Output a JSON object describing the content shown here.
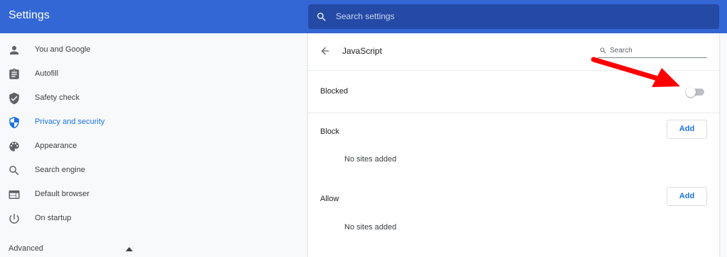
{
  "header": {
    "app_title": "Settings",
    "search_placeholder": "Search settings"
  },
  "sidebar": {
    "items": [
      {
        "label": "You and Google",
        "icon": "person-icon",
        "active": false
      },
      {
        "label": "Autofill",
        "icon": "clipboard-icon",
        "active": false
      },
      {
        "label": "Safety check",
        "icon": "shield-check-icon",
        "active": false
      },
      {
        "label": "Privacy and security",
        "icon": "shield-icon",
        "active": true
      },
      {
        "label": "Appearance",
        "icon": "palette-icon",
        "active": false
      },
      {
        "label": "Search engine",
        "icon": "search-icon",
        "active": false
      },
      {
        "label": "Default browser",
        "icon": "browser-icon",
        "active": false
      },
      {
        "label": "On startup",
        "icon": "power-icon",
        "active": false
      }
    ],
    "advanced_label": "Advanced"
  },
  "panel": {
    "title": "JavaScript",
    "search_placeholder": "Search",
    "blocked_label": "Blocked",
    "blocked_toggle_on": false,
    "block_section": {
      "label": "Block",
      "add_label": "Add",
      "empty_text": "No sites added"
    },
    "allow_section": {
      "label": "Allow",
      "add_label": "Add",
      "empty_text": "No sites added"
    }
  },
  "colors": {
    "header": "#3367d6",
    "search_bar": "#254aa5",
    "accent": "#1a73e8",
    "annotation_arrow": "#ff0000"
  }
}
